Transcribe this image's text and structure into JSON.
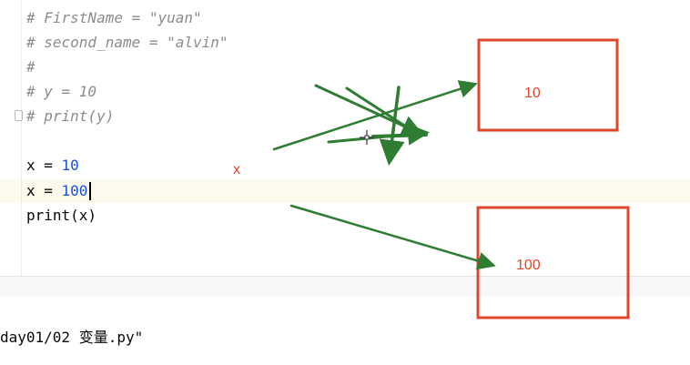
{
  "editor": {
    "lines": [
      {
        "text": "# FirstName = \"yuan\"",
        "kind": "comment"
      },
      {
        "text": "# second_name = \"alvin\"",
        "kind": "comment"
      },
      {
        "text": "#",
        "kind": "comment"
      },
      {
        "text": "# y = 10",
        "kind": "comment"
      },
      {
        "text": "# print(y)",
        "kind": "comment"
      },
      {
        "text": "",
        "kind": "blank"
      },
      {
        "code": "x = ",
        "num": "10",
        "kind": "assign"
      },
      {
        "code": "x = ",
        "num": "100",
        "kind": "assign"
      },
      {
        "text": "print(x)",
        "kind": "code"
      }
    ]
  },
  "run": {
    "path": "day01/02 变量.py\""
  },
  "annotation": {
    "box1_value": "10",
    "box2_value": "100",
    "var_label": "x"
  },
  "colors": {
    "arrow": "#2e7d32",
    "box": "#e0472a",
    "comment": "#8c8c8c",
    "number": "#1750eb"
  }
}
